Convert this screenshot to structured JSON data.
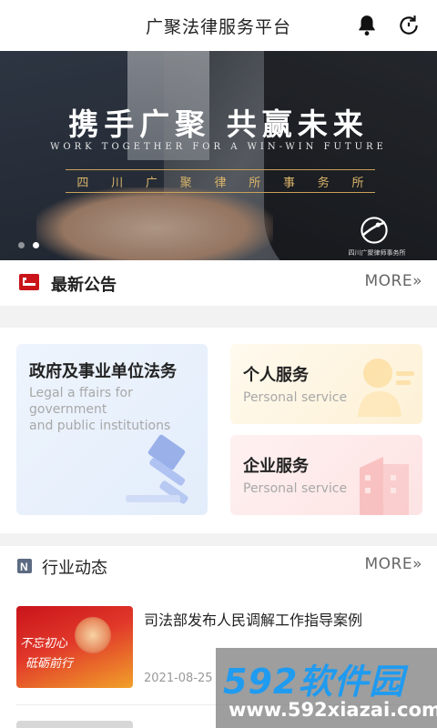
{
  "header": {
    "title": "广聚法律服务平台",
    "bell_icon": "bell-icon",
    "refresh_icon": "refresh-icon"
  },
  "banner": {
    "title": "携手广聚  共赢未来",
    "subtitle": "WORK TOGETHER FOR A WIN-WIN FUTURE",
    "firm_chars": [
      "四",
      "川",
      "广",
      "聚",
      "律",
      "所",
      "事",
      "务",
      "所"
    ],
    "logo_caption": "四川广聚律师事务所",
    "slide_count": 2,
    "active_slide": 1
  },
  "notice": {
    "title": "最新公告",
    "more": "MORE»",
    "icon": "announcement-icon"
  },
  "services": {
    "government": {
      "title": "政府及事业单位法务",
      "subtitle_lines": [
        "Legal a ffairs for",
        "government",
        "and public institutions"
      ],
      "icon": "gavel-icon"
    },
    "personal": {
      "title": "个人服务",
      "subtitle": "Personal service",
      "icon": "person-icon"
    },
    "enterprise": {
      "title": "企业服务",
      "subtitle": "Personal service",
      "icon": "building-icon"
    }
  },
  "news": {
    "title": "行业动态",
    "more": "MORE»",
    "items": [
      {
        "title": "司法部发布人民调解工作指导案例",
        "date": "2021-08-25",
        "thumb_text": [
          "不忘初心",
          "砥砺前行"
        ]
      }
    ]
  },
  "watermark": {
    "brand": "592软件园",
    "url": "www.592xiazai.com"
  },
  "colors": {
    "accent_red": "#c9141a",
    "gold": "#c7a15a",
    "watermark_blue": "#1f9bf0"
  }
}
